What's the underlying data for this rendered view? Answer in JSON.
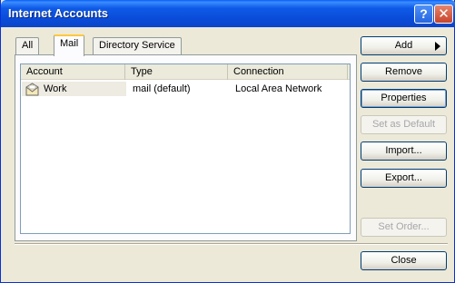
{
  "window": {
    "title": "Internet Accounts",
    "help_label": "?",
    "close_label": "✕"
  },
  "tabs": [
    {
      "label": "All"
    },
    {
      "label": "Mail",
      "active": true
    },
    {
      "label": "Directory Service"
    }
  ],
  "list": {
    "columns": [
      "Account",
      "Type",
      "Connection"
    ],
    "rows": [
      {
        "account": "Work",
        "type": "mail (default)",
        "connection": "Local Area Network",
        "icon": "mail-account-icon"
      }
    ]
  },
  "buttons": {
    "add": "Add",
    "remove": "Remove",
    "properties": "Properties",
    "set_default": "Set as Default",
    "import": "Import...",
    "export": "Export...",
    "set_order": "Set Order...",
    "close": "Close"
  },
  "colors": {
    "titlebar": "#0A4BD8",
    "face": "#ECE9D8",
    "active_tab_accent": "#FFC83C"
  }
}
